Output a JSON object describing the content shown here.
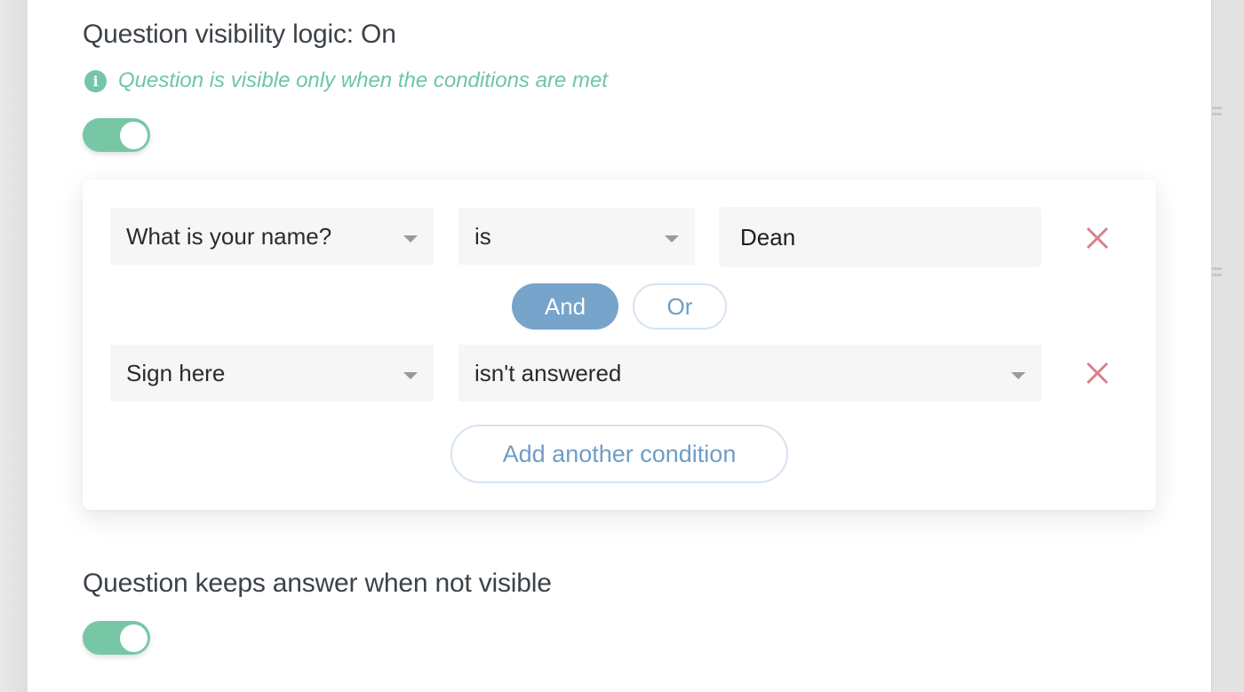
{
  "visibility_section": {
    "title": "Question visibility logic: On",
    "hint_icon": "info-icon",
    "hint_text": "Question is visible only when the conditions are met",
    "toggle_on": true
  },
  "conditions": {
    "rows": [
      {
        "question": "What is your name?",
        "operator": "is",
        "value": "Dean",
        "remove_icon": "close-icon"
      },
      {
        "question": "Sign here",
        "operator": "isn't answered",
        "remove_icon": "close-icon"
      }
    ],
    "combinator": {
      "options": [
        "And",
        "Or"
      ],
      "selected": "And"
    },
    "add_condition_label": "Add another condition"
  },
  "keep_answer_section": {
    "title": "Question keeps answer when not visible",
    "toggle_on": true
  },
  "colors": {
    "accent_green": "#77c7a7",
    "accent_blue": "#76a4cb",
    "remove_red": "#d9808a",
    "title_text": "#3c4249"
  }
}
